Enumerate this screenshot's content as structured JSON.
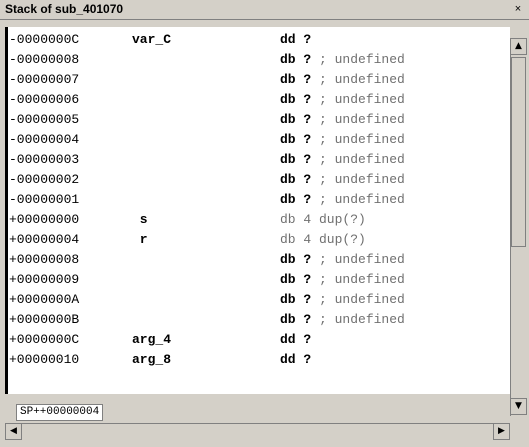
{
  "window": {
    "title": "Stack of sub_401070",
    "close_glyph": "×"
  },
  "rows": [
    {
      "offset": "-0000000C",
      "name": "var_C",
      "type": "dd ?",
      "comment": ""
    },
    {
      "offset": "-00000008",
      "name": "",
      "type": "db ?",
      "comment": " ; undefined"
    },
    {
      "offset": "-00000007",
      "name": "",
      "type": "db ?",
      "comment": " ; undefined"
    },
    {
      "offset": "-00000006",
      "name": "",
      "type": "db ?",
      "comment": " ; undefined"
    },
    {
      "offset": "-00000005",
      "name": "",
      "type": "db ?",
      "comment": " ; undefined"
    },
    {
      "offset": "-00000004",
      "name": "",
      "type": "db ?",
      "comment": " ; undefined"
    },
    {
      "offset": "-00000003",
      "name": "",
      "type": "db ?",
      "comment": " ; undefined"
    },
    {
      "offset": "-00000002",
      "name": "",
      "type": "db ?",
      "comment": " ; undefined"
    },
    {
      "offset": "-00000001",
      "name": "",
      "type": "db ?",
      "comment": " ; undefined"
    },
    {
      "offset": "+00000000",
      "name": " s",
      "type": "db 4 dup(?)",
      "comment": ""
    },
    {
      "offset": "+00000004",
      "name": " r",
      "type": "db 4 dup(?)",
      "comment": ""
    },
    {
      "offset": "+00000008",
      "name": "",
      "type": "db ?",
      "comment": " ; undefined"
    },
    {
      "offset": "+00000009",
      "name": "",
      "type": "db ?",
      "comment": " ; undefined"
    },
    {
      "offset": "+0000000A",
      "name": "",
      "type": "db ?",
      "comment": " ; undefined"
    },
    {
      "offset": "+0000000B",
      "name": "",
      "type": "db ?",
      "comment": " ; undefined"
    },
    {
      "offset": "+0000000C",
      "name": "arg_4",
      "type": "dd ?",
      "comment": ""
    },
    {
      "offset": "+00000010",
      "name": "arg_8",
      "type": "dd ?",
      "comment": ""
    }
  ],
  "status": {
    "text": "SP++00000004"
  },
  "scrollbar": {
    "up_glyph": "▲",
    "down_glyph": "▼",
    "left_glyph": "◀",
    "right_glyph": "▶"
  }
}
